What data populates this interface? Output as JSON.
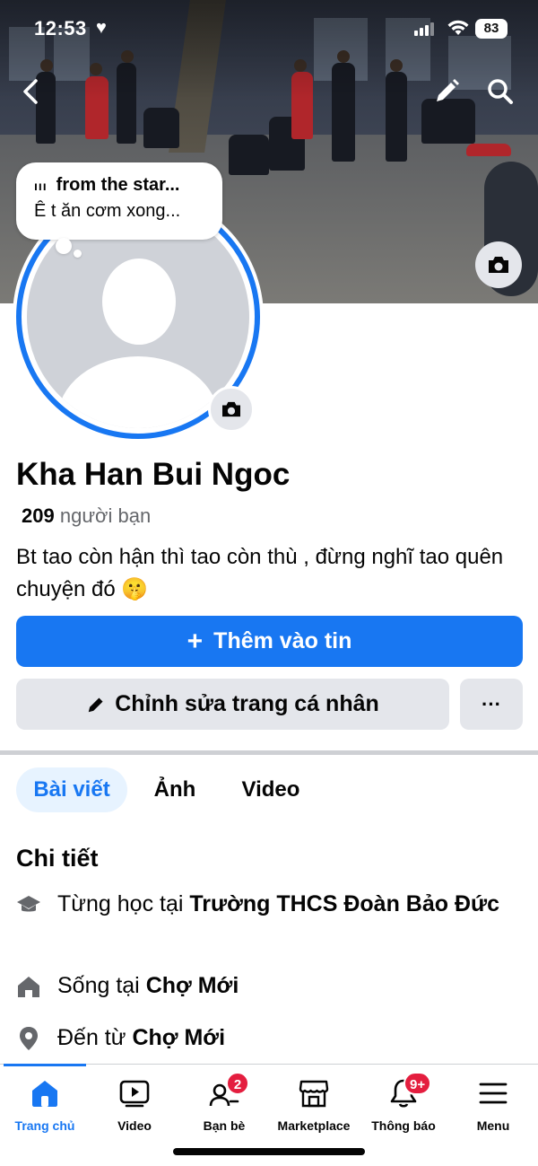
{
  "status_bar": {
    "time": "12:53",
    "heart": "♥",
    "battery": "83"
  },
  "note": {
    "music_prefix": "ııı",
    "song": "from the star...",
    "text": "Ê t ăn cơm xong..."
  },
  "profile": {
    "name": "Kha Han Bui Ngoc",
    "friends_count": "209",
    "friends_label": "người bạn",
    "bio": "Bt tao còn hận thì tao còn thù , đừng nghĩ tao quên chuyện đó 🤫"
  },
  "actions": {
    "add_story_icon": "+",
    "add_story_label": "Thêm vào tin",
    "edit_profile_label": "Chỉnh sửa trang cá nhân",
    "more_label": "···"
  },
  "tabs": [
    {
      "label": "Bài viết",
      "active": true
    },
    {
      "label": "Ảnh",
      "active": false
    },
    {
      "label": "Video",
      "active": false
    }
  ],
  "details": {
    "title": "Chi tiết",
    "items": [
      {
        "icon": "graduation-cap-icon",
        "prefix": "Từng học tại ",
        "value": "Trường THCS Đoàn Bảo Đức"
      },
      {
        "icon": "home-icon",
        "prefix": "Sống tại ",
        "value": "Chợ Mới"
      },
      {
        "icon": "location-pin-icon",
        "prefix": "Đến từ ",
        "value": "Chợ Mới"
      }
    ]
  },
  "bottom_nav": [
    {
      "label": "Trang chủ",
      "icon": "home-icon",
      "active": true
    },
    {
      "label": "Video",
      "icon": "video-icon",
      "active": false
    },
    {
      "label": "Bạn bè",
      "icon": "friends-icon",
      "badge": "2"
    },
    {
      "label": "Marketplace",
      "icon": "marketplace-icon"
    },
    {
      "label": "Thông báo",
      "icon": "bell-icon",
      "badge": "9+"
    },
    {
      "label": "Menu",
      "icon": "menu-icon"
    }
  ],
  "colors": {
    "accent": "#1877f2",
    "secondary_button": "#e4e6eb",
    "badge": "#e41e3f",
    "muted_text": "#65676b"
  }
}
